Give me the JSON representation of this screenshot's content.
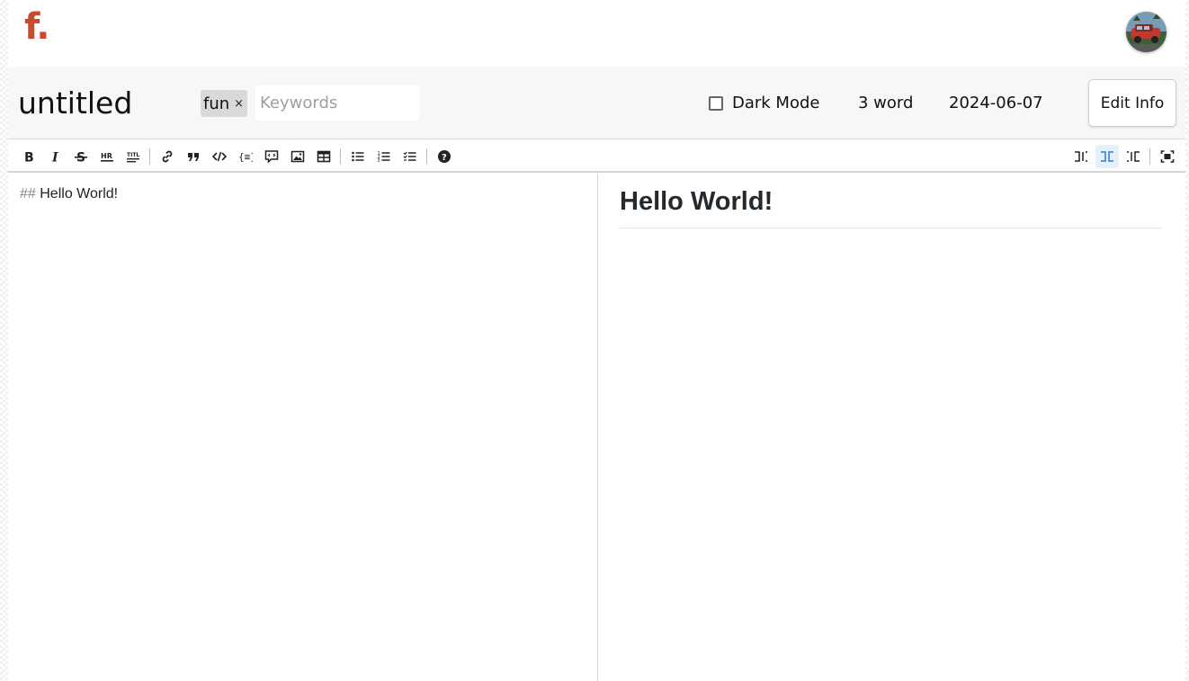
{
  "brand": {
    "logo_text": "f.",
    "accent": "#c94a2f"
  },
  "user": {
    "avatar": "avatar-image"
  },
  "document": {
    "title": "untitled",
    "tags": [
      {
        "label": "fun",
        "remove": "×"
      }
    ],
    "keywords_placeholder": "Keywords",
    "dark_mode_label": "Dark Mode",
    "dark_mode_checked": false,
    "word_count": "3 word",
    "date": "2024-06-07",
    "edit_info_label": "Edit Info"
  },
  "toolbar": {
    "left": [
      "bold-icon",
      "italic-icon",
      "strikethrough-icon",
      "horizontal-rule-icon",
      "title-icon",
      "link-icon",
      "quote-icon",
      "code-icon",
      "code-block-icon",
      "comment-icon",
      "image-icon",
      "table-icon",
      "unordered-list-icon",
      "ordered-list-icon",
      "checklist-icon",
      "help-icon"
    ],
    "right": [
      "view-editor-only-icon",
      "view-split-icon",
      "view-preview-only-icon",
      "fullscreen-icon"
    ],
    "active": "view-split-icon"
  },
  "editor": {
    "markup": "##",
    "text": "Hello World!"
  },
  "preview": {
    "heading": "Hello World!"
  }
}
